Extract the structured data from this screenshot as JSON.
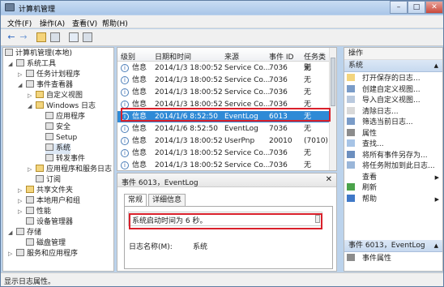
{
  "window": {
    "title": "计算机管理",
    "minimize": "–",
    "maximize": "□",
    "close": "✕"
  },
  "menu": {
    "file": "文件(F)",
    "action": "操作(A)",
    "view": "查看(V)",
    "help": "帮助(H)"
  },
  "toolbar": {
    "back": "←",
    "forward": "→"
  },
  "tree": {
    "items": [
      {
        "label": "计算机管理(本地)",
        "twisty": "",
        "icon": "computer-icon"
      },
      {
        "label": "系统工具",
        "twisty": "◢",
        "icon": "tools-icon"
      },
      {
        "label": "任务计划程序",
        "twisty": "▷",
        "icon": "task-scheduler-icon"
      },
      {
        "label": "事件查看器",
        "twisty": "◢",
        "icon": "event-viewer-icon"
      },
      {
        "label": "自定义视图",
        "twisty": "▷",
        "icon": "folder-icon"
      },
      {
        "label": "Windows 日志",
        "twisty": "◢",
        "icon": "folder-icon"
      },
      {
        "label": "应用程序",
        "twisty": "",
        "icon": "log-icon"
      },
      {
        "label": "安全",
        "twisty": "",
        "icon": "log-icon"
      },
      {
        "label": "Setup",
        "twisty": "",
        "icon": "log-icon"
      },
      {
        "label": "系统",
        "twisty": "",
        "icon": "log-icon"
      },
      {
        "label": "转发事件",
        "twisty": "",
        "icon": "log-icon"
      },
      {
        "label": "应用程序和服务日志",
        "twisty": "▷",
        "icon": "folder-icon"
      },
      {
        "label": "订阅",
        "twisty": "",
        "icon": "subscription-icon"
      },
      {
        "label": "共享文件夹",
        "twisty": "▷",
        "icon": "shared-folder-icon"
      },
      {
        "label": "本地用户和组",
        "twisty": "▷",
        "icon": "users-icon"
      },
      {
        "label": "性能",
        "twisty": "▷",
        "icon": "performance-icon"
      },
      {
        "label": "设备管理器",
        "twisty": "",
        "icon": "device-manager-icon"
      },
      {
        "label": "存储",
        "twisty": "◢",
        "icon": "storage-icon"
      },
      {
        "label": "磁盘管理",
        "twisty": "",
        "icon": "disk-icon"
      },
      {
        "label": "服务和应用程序",
        "twisty": "▷",
        "icon": "services-icon"
      }
    ]
  },
  "list": {
    "columns": {
      "level": "级别",
      "datetime": "日期和时间",
      "source": "来源",
      "eventid": "事件 ID",
      "category": "任务类别"
    },
    "rows": [
      {
        "level": "信息",
        "datetime": "2014/1/3 18:00:52",
        "source": "Service Co...",
        "eventid": "7036",
        "category": "无"
      },
      {
        "level": "信息",
        "datetime": "2014/1/3 18:00:52",
        "source": "Service Co...",
        "eventid": "7036",
        "category": "无"
      },
      {
        "level": "信息",
        "datetime": "2014/1/3 18:00:52",
        "source": "Service Co...",
        "eventid": "7036",
        "category": "无"
      },
      {
        "level": "信息",
        "datetime": "2014/1/3 18:00:52",
        "source": "Service Co...",
        "eventid": "7036",
        "category": "无"
      },
      {
        "level": "信息",
        "datetime": "2014/1/6 8:52:50",
        "source": "EventLog",
        "eventid": "6013",
        "category": "无"
      },
      {
        "level": "信息",
        "datetime": "2014/1/6 8:52:50",
        "source": "EventLog",
        "eventid": "7036",
        "category": "无"
      },
      {
        "level": "信息",
        "datetime": "2014/1/3 18:00:52",
        "source": "UserPnp",
        "eventid": "20010",
        "category": "(7010)"
      },
      {
        "level": "信息",
        "datetime": "2014/1/3 18:00:52",
        "source": "Service Co...",
        "eventid": "7036",
        "category": "无"
      },
      {
        "level": "信息",
        "datetime": "2014/1/3 18:00:52",
        "source": "Service Co...",
        "eventid": "7036",
        "category": "无"
      }
    ],
    "selected_index": 4
  },
  "detail": {
    "header": "事件 6013，EventLog",
    "close": "✕",
    "tab_general": "常规",
    "tab_details": "详细信息",
    "message": "系统启动时间为 6 秒。",
    "logname_label": "日志名称(M):",
    "logname_value": "系统"
  },
  "actions": {
    "header1": "操作",
    "section1": "系统",
    "items1": [
      {
        "label": "打开保存的日志...",
        "icon": "open-log-icon",
        "arrow": ""
      },
      {
        "label": "创建自定义视图...",
        "icon": "filter-icon",
        "arrow": ""
      },
      {
        "label": "导入自定义视图...",
        "icon": "import-icon",
        "arrow": ""
      },
      {
        "label": "清除日志...",
        "icon": "clear-icon",
        "arrow": ""
      },
      {
        "label": "筛选当前日志...",
        "icon": "filter-icon",
        "arrow": ""
      },
      {
        "label": "属性",
        "icon": "properties-icon",
        "arrow": ""
      },
      {
        "label": "查找...",
        "icon": "find-icon",
        "arrow": ""
      },
      {
        "label": "将所有事件另存为...",
        "icon": "save-icon",
        "arrow": ""
      },
      {
        "label": "将任务附加到此日志...",
        "icon": "attach-task-icon",
        "arrow": ""
      },
      {
        "label": "查看",
        "icon": "none",
        "arrow": "▶"
      },
      {
        "label": "刷新",
        "icon": "refresh-icon",
        "arrow": ""
      },
      {
        "label": "帮助",
        "icon": "help-icon",
        "arrow": "▶"
      }
    ],
    "section2": "事件 6013，EventLog",
    "items2": [
      {
        "label": "事件属性",
        "icon": "event-properties-icon",
        "arrow": ""
      }
    ]
  },
  "status": {
    "text": "显示日志属性。"
  }
}
